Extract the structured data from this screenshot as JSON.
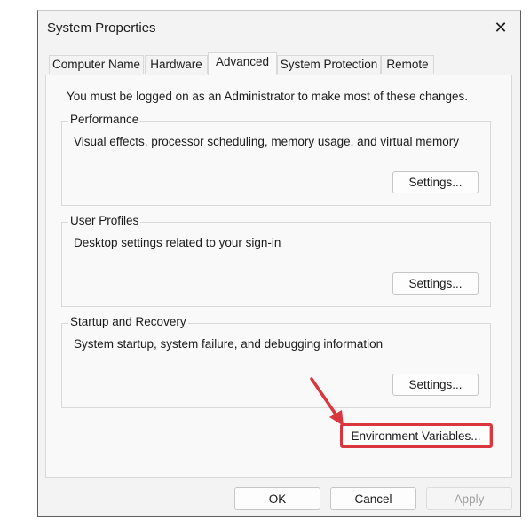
{
  "window": {
    "title": "System Properties",
    "close_glyph": "✕"
  },
  "tabs": [
    {
      "label": "Computer Name",
      "active": false
    },
    {
      "label": "Hardware",
      "active": false
    },
    {
      "label": "Advanced",
      "active": true
    },
    {
      "label": "System Protection",
      "active": false
    },
    {
      "label": "Remote",
      "active": false
    }
  ],
  "advanced": {
    "notice": "You must be logged on as an Administrator to make most of these changes.",
    "groups": [
      {
        "label": "Performance",
        "description": "Visual effects, processor scheduling, memory usage, and virtual memory",
        "button_label": "Settings..."
      },
      {
        "label": "User Profiles",
        "description": "Desktop settings related to your sign-in",
        "button_label": "Settings..."
      },
      {
        "label": "Startup and Recovery",
        "description": "System startup, system failure, and debugging information",
        "button_label": "Settings..."
      }
    ],
    "env_button_label": "Environment Variables..."
  },
  "footer": {
    "ok_label": "OK",
    "cancel_label": "Cancel",
    "apply_label": "Apply",
    "apply_enabled": false
  },
  "annotation": {
    "highlight_color": "#d9363e",
    "target": "Environment Variables..."
  }
}
